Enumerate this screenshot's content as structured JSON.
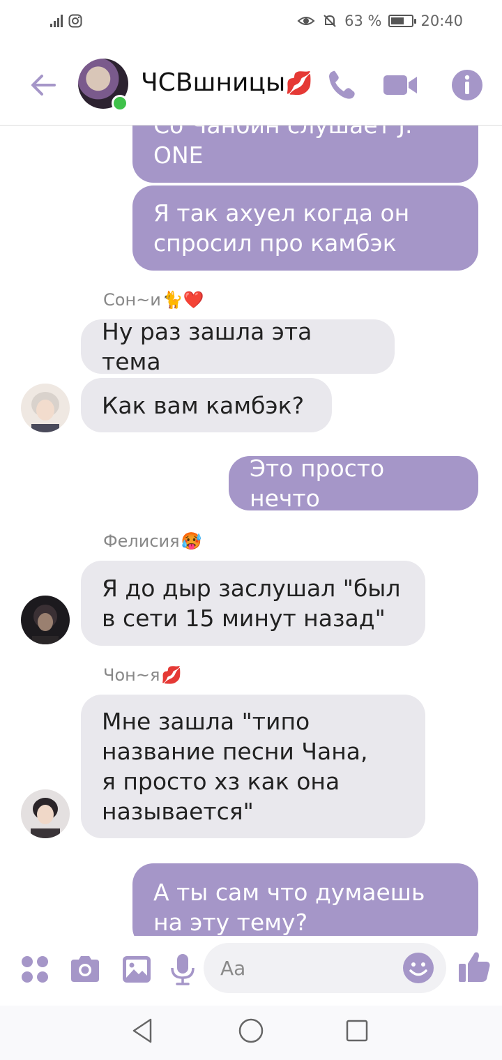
{
  "status_bar": {
    "battery_percent": "63 %",
    "time": "20:40",
    "battery_level": 0.63
  },
  "header": {
    "title": "ЧСВшницы",
    "title_emoji": "💋"
  },
  "messages": [
    {
      "type": "outgoing",
      "text": "Со Чанбин слушает J.\nONE"
    },
    {
      "type": "outgoing",
      "text": "Я так ахуел когда он\nспросил про камбэк"
    },
    {
      "type": "sender",
      "name": "Сон~и",
      "emoji": "🐈❤️"
    },
    {
      "type": "incoming",
      "text": "Ну раз зашла эта тема"
    },
    {
      "type": "incoming",
      "text": "Как вам камбэк?"
    },
    {
      "type": "outgoing",
      "text": "Это просто нечто"
    },
    {
      "type": "sender",
      "name": "Фелисия",
      "emoji": "🥵"
    },
    {
      "type": "incoming",
      "text": "Я до дыр заслушал \"был\nв сети 15 минут назад\""
    },
    {
      "type": "sender",
      "name": "Чон~я",
      "emoji": "💋"
    },
    {
      "type": "incoming",
      "text": "Мне зашла \"типо\nназвание песни Чана,\nя просто хз как она\nназывается\""
    },
    {
      "type": "outgoing",
      "text": "А ты сам что думаешь\nна эту тему?"
    }
  ],
  "input": {
    "placeholder": "Aa"
  },
  "colors": {
    "accent": "#a596c8",
    "outgoing_bubble": "#a596c8",
    "incoming_bubble": "#e9e8ed",
    "online": "#3fc24a"
  },
  "icons": [
    "back-arrow-icon",
    "phone-icon",
    "video-icon",
    "info-icon",
    "apps-icon",
    "camera-icon",
    "gallery-icon",
    "microphone-icon",
    "emoji-icon",
    "like-icon",
    "nav-back-icon",
    "nav-home-icon",
    "nav-recents-icon"
  ]
}
